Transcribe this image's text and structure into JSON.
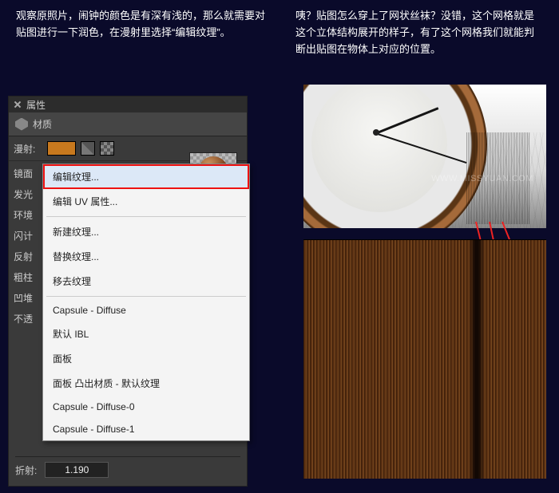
{
  "top_left_text": "观察原照片，闹钟的颜色是有深有浅的，那么就需要对贴图进行一下润色，在漫射里选择“编辑纹理”。",
  "top_right_text": "咦？贴图怎么穿上了网状丝袜？没错，这个网格就是这个立体结构展开的样子，有了这个网格我们就能判断出贴图在物体上对应的位置。",
  "panel": {
    "title": "属性",
    "section_label": "材质",
    "diffuse_label": "漫射:",
    "rows": [
      "镜面",
      "发光",
      "环境",
      "闪计",
      "反射",
      "粗柱",
      "凹堆",
      "不透",
      "折射:"
    ],
    "refraction_label": "折射:",
    "refraction_value": "1.190"
  },
  "menu": {
    "items": [
      "编辑纹理...",
      "编辑 UV 属性...",
      "新建纹理...",
      "替换纹理...",
      "移去纹理",
      "Capsule - Diffuse",
      "默认 IBL",
      "面板",
      "面板 凸出材质 - 默认纹理",
      "Capsule - Diffuse-0",
      "Capsule - Diffuse-1"
    ]
  },
  "watermark": "WWW.MISSYUAN.COM"
}
